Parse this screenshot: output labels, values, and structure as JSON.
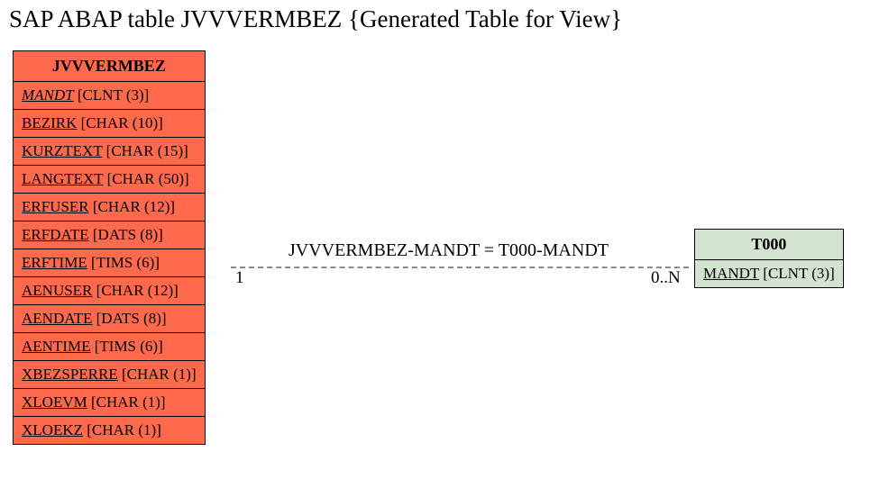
{
  "title": "SAP ABAP table JVVVERMBEZ {Generated Table for View}",
  "leftEntity": {
    "name": "JVVVERMBEZ",
    "fields": [
      {
        "name": "MANDT",
        "type": "[CLNT (3)]",
        "key": true
      },
      {
        "name": "BEZIRK",
        "type": "[CHAR (10)]",
        "key": false
      },
      {
        "name": "KURZTEXT",
        "type": "[CHAR (15)]",
        "key": false
      },
      {
        "name": "LANGTEXT",
        "type": "[CHAR (50)]",
        "key": false
      },
      {
        "name": "ERFUSER",
        "type": "[CHAR (12)]",
        "key": false
      },
      {
        "name": "ERFDATE",
        "type": "[DATS (8)]",
        "key": false
      },
      {
        "name": "ERFTIME",
        "type": "[TIMS (6)]",
        "key": false
      },
      {
        "name": "AENUSER",
        "type": "[CHAR (12)]",
        "key": false
      },
      {
        "name": "AENDATE",
        "type": "[DATS (8)]",
        "key": false
      },
      {
        "name": "AENTIME",
        "type": "[TIMS (6)]",
        "key": false
      },
      {
        "name": "XBEZSPERRE",
        "type": "[CHAR (1)]",
        "key": false
      },
      {
        "name": "XLOEVM",
        "type": "[CHAR (1)]",
        "key": false
      },
      {
        "name": "XLOEKZ",
        "type": "[CHAR (1)]",
        "key": false
      }
    ]
  },
  "rightEntity": {
    "name": "T000",
    "fields": [
      {
        "name": "MANDT",
        "type": "[CLNT (3)]",
        "key": false
      }
    ]
  },
  "relation": {
    "label": "JVVVERMBEZ-MANDT = T000-MANDT",
    "leftCardinality": "1",
    "rightCardinality": "0..N"
  }
}
